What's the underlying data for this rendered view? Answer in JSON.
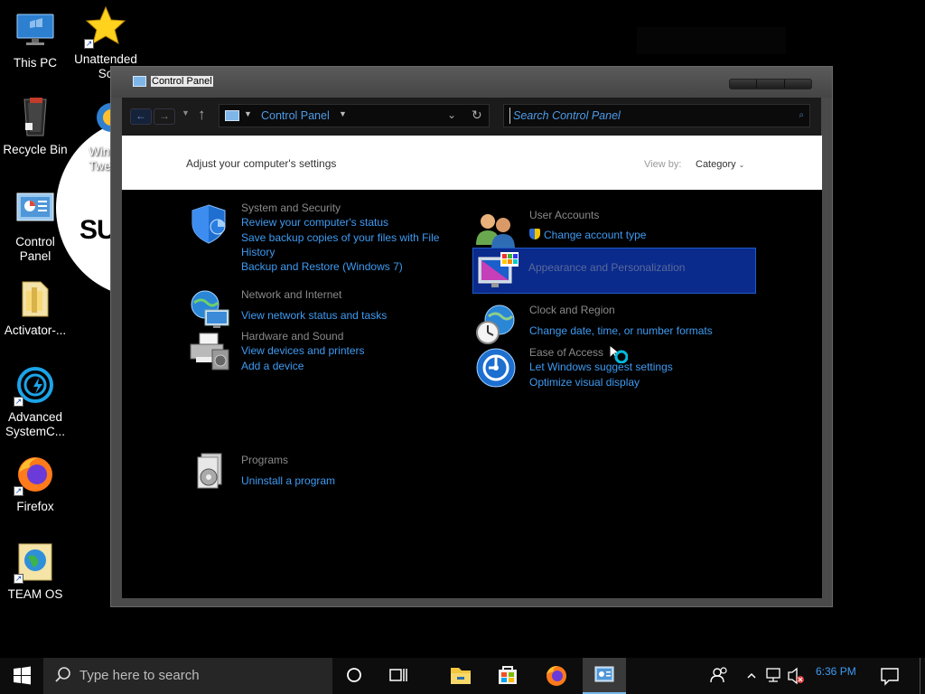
{
  "desktop": {
    "icons": [
      {
        "label": "This PC"
      },
      {
        "label": "Recycle Bin"
      },
      {
        "label": "Control Panel"
      },
      {
        "label": "Activator-..."
      },
      {
        "label": "Advanced SystemC..."
      },
      {
        "label": "Firefox"
      },
      {
        "label": "TEAM OS"
      },
      {
        "label": "Unattended So"
      },
      {
        "label": "Wina Twea"
      }
    ],
    "blob_text": "SU"
  },
  "window": {
    "title": "Control Panel",
    "address": {
      "location": "Control Panel"
    },
    "search": {
      "placeholder": "Search Control Panel"
    },
    "header": {
      "title": "Adjust your computer's settings",
      "view_by_label": "View by:",
      "view_by_value": "Category"
    },
    "categories": [
      {
        "title": "System and Security",
        "icon": "shield-icon",
        "links": [
          "Review your computer's status",
          "Save backup copies of your files with File",
          "History",
          "Backup and Restore (Windows 7)"
        ]
      },
      {
        "title": "Network and Internet",
        "icon": "network-icon",
        "links": [
          "View network status and tasks"
        ]
      },
      {
        "title": "Hardware and Sound",
        "icon": "printer-icon",
        "links": [
          "View devices and printers",
          "Add a device"
        ]
      },
      {
        "title": "Programs",
        "icon": "programs-icon",
        "links": [
          "Uninstall a program"
        ]
      },
      {
        "title": "User Accounts",
        "icon": "users-icon",
        "links": [
          "Change account type"
        ]
      },
      {
        "title": "Appearance and Personalization",
        "icon": "display-icon",
        "links": [],
        "selected": true
      },
      {
        "title": "Clock and Region",
        "icon": "clock-globe-icon",
        "links": [
          "Change date, time, or number formats"
        ]
      },
      {
        "title": "Ease of Access",
        "icon": "ease-of-access-icon",
        "links": [
          "Let Windows suggest settings",
          "Optimize visual display"
        ]
      }
    ]
  },
  "taskbar": {
    "search_placeholder": "Type here to search",
    "time": "6:36 PM",
    "colors": {
      "accent": "#3e9bf2",
      "selection": "#0a2a8c"
    }
  }
}
